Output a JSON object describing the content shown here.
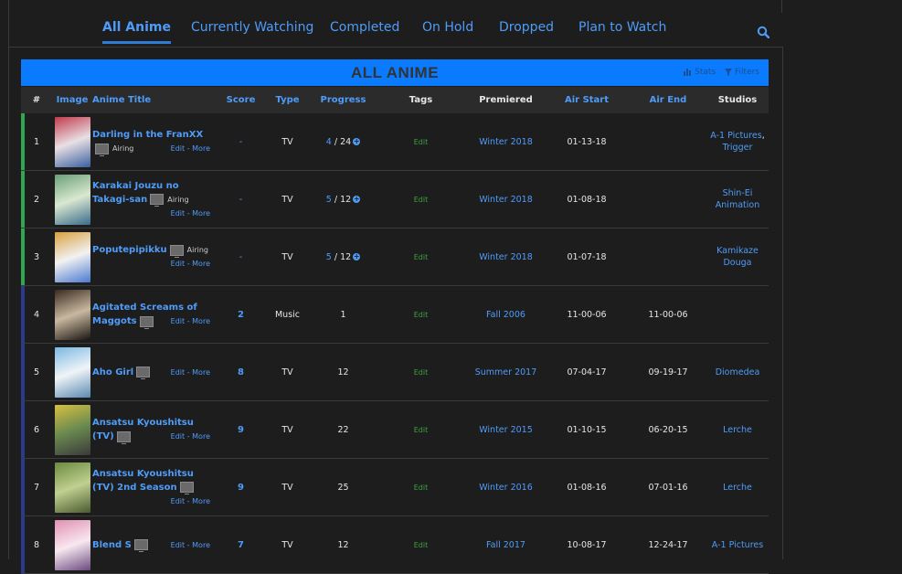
{
  "tabs": [
    "All Anime",
    "Currently Watching",
    "Completed",
    "On Hold",
    "Dropped",
    "Plan to Watch"
  ],
  "list": {
    "title": "ALL ANIME",
    "stats_label": "Stats",
    "filters_label": "Filters"
  },
  "columns": {
    "num": "#",
    "image": "Image",
    "title": "Anime Title",
    "score": "Score",
    "type": "Type",
    "progress": "Progress",
    "tags": "Tags",
    "premiered": "Premiered",
    "air_start": "Air Start",
    "air_end": "Air End",
    "studios": "Studios"
  },
  "labels": {
    "airing": "Airing",
    "edit": "Edit",
    "more": "More",
    "tag_edit": "Edit",
    "progress_sep": " / "
  },
  "colors": {
    "watching": "#2fa84f",
    "completed": "#2a3b8f",
    "header_bar": "#0a7bff",
    "link": "#4f9cf8"
  },
  "rows": [
    {
      "num": "1",
      "title": "Darling in the FranXX",
      "airing": true,
      "score": "-",
      "type": "TV",
      "watched": "4",
      "total": "24",
      "premiered": "Winter 2018",
      "air_start": "01-13-18",
      "air_end": "",
      "studios": [
        "A-1 Pictures",
        ", ",
        "Trigger"
      ],
      "status": "watching"
    },
    {
      "num": "2",
      "title": "Karakai Jouzu no Takagi-san",
      "airing": true,
      "score": "-",
      "type": "TV",
      "watched": "5",
      "total": "12",
      "premiered": "Winter 2018",
      "air_start": "01-08-18",
      "air_end": "",
      "studios": [
        "Shin-Ei Animation"
      ],
      "status": "watching"
    },
    {
      "num": "3",
      "title": "Poputepipikku",
      "airing": true,
      "score": "-",
      "type": "TV",
      "watched": "5",
      "total": "12",
      "premiered": "Winter 2018",
      "air_start": "01-07-18",
      "air_end": "",
      "studios": [
        "Kamikaze Douga"
      ],
      "status": "watching"
    },
    {
      "num": "4",
      "title": "Agitated Screams of Maggots",
      "airing": false,
      "score": "2",
      "type": "Music",
      "watched": "",
      "total": "1",
      "premiered": "Fall 2006",
      "air_start": "11-00-06",
      "air_end": "11-00-06",
      "studios": [],
      "status": "completed"
    },
    {
      "num": "5",
      "title": "Aho Girl",
      "airing": false,
      "score": "8",
      "type": "TV",
      "watched": "",
      "total": "12",
      "premiered": "Summer 2017",
      "air_start": "07-04-17",
      "air_end": "09-19-17",
      "studios": [
        "Diomedea"
      ],
      "status": "completed"
    },
    {
      "num": "6",
      "title": "Ansatsu Kyoushitsu (TV)",
      "airing": false,
      "score": "9",
      "type": "TV",
      "watched": "",
      "total": "22",
      "premiered": "Winter 2015",
      "air_start": "01-10-15",
      "air_end": "06-20-15",
      "studios": [
        "Lerche"
      ],
      "status": "completed"
    },
    {
      "num": "7",
      "title": "Ansatsu Kyoushitsu (TV) 2nd Season",
      "airing": false,
      "score": "9",
      "type": "TV",
      "watched": "",
      "total": "25",
      "premiered": "Winter 2016",
      "air_start": "01-08-16",
      "air_end": "07-01-16",
      "studios": [
        "Lerche"
      ],
      "status": "completed"
    },
    {
      "num": "8",
      "title": "Blend S",
      "airing": false,
      "score": "7",
      "type": "TV",
      "watched": "",
      "total": "12",
      "premiered": "Fall 2017",
      "air_start": "10-08-17",
      "air_end": "12-24-17",
      "studios": [
        "A-1 Pictures"
      ],
      "status": "completed"
    }
  ]
}
